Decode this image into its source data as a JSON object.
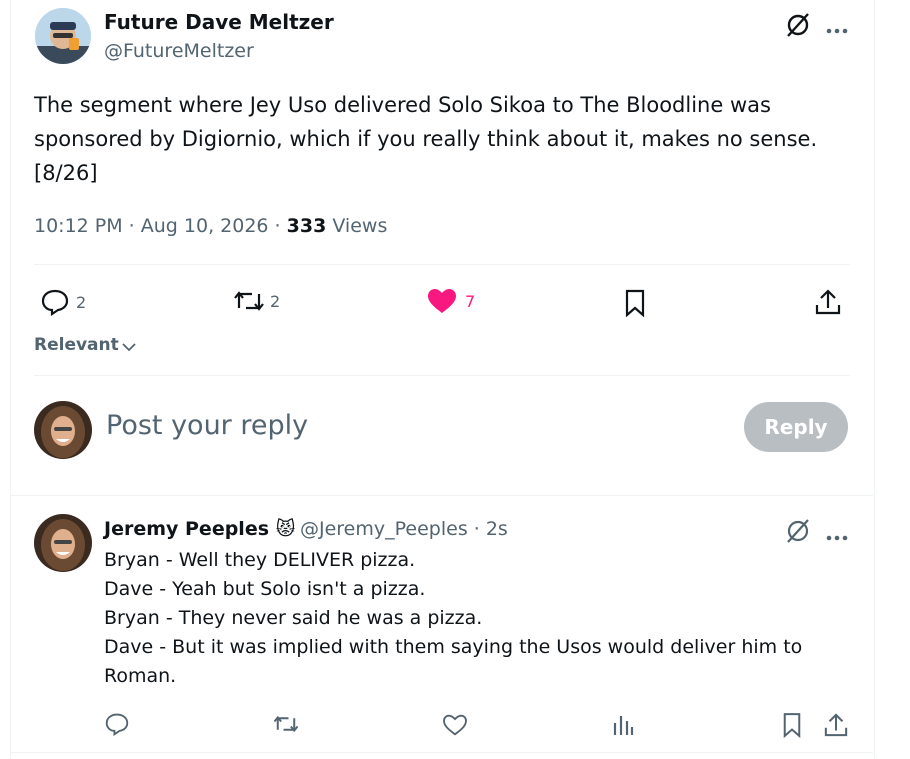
{
  "tweet": {
    "author_name": "Future Dave Meltzer",
    "author_handle": "@FutureMeltzer",
    "text": "The segment where Jey Uso delivered Solo Sikoa to The Bloodline was sponsored by Digiornio, which if you really think about it, makes no sense. [8/26]",
    "time": "10:12 PM · Aug 10, 2026 · ",
    "views_count": "333",
    "views_label": " Views",
    "replies": "2",
    "retweets": "2",
    "likes": "7"
  },
  "sort": {
    "label": "Relevant"
  },
  "composer": {
    "placeholder": "Post your reply",
    "button_label": "Reply"
  },
  "reply": {
    "author_name": "Jeremy Peeples",
    "emoji": "😾",
    "author_handle": "@Jeremy_Peeples · 2s",
    "lines": [
      "Bryan - Well they DELIVER pizza.",
      "Dave - Yeah but Solo isn't a pizza.",
      "Bryan - They never said he was a pizza.",
      "Dave - But it was implied with them saying the Usos would deliver him to Roman."
    ]
  },
  "colors": {
    "like": "#f91880",
    "muted": "#536471",
    "button_disabled": "#b9bec2"
  }
}
